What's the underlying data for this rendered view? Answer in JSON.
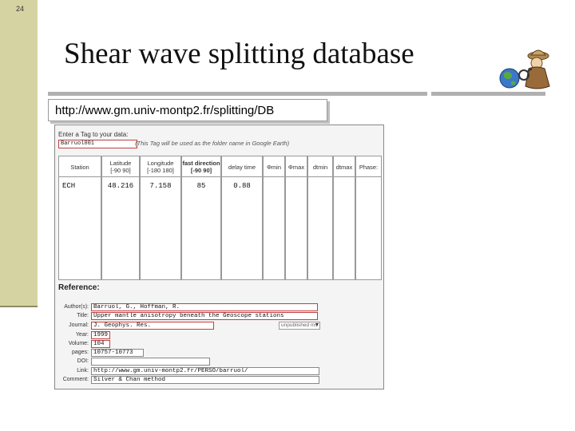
{
  "slide": {
    "number": "24",
    "title": "Shear wave splitting database",
    "url": "http://www.gm.univ-montp2.fr/splitting/DB"
  },
  "form": {
    "tag_label": "Enter a Tag to your data:",
    "tag_value": "Barruol001",
    "tag_note": "(This Tag will be used as the folder name in Google Earth)",
    "headers": {
      "station": "Station",
      "latitude": "Latitude",
      "latitude_range": "[-90 90]",
      "longitude": "Longitude",
      "longitude_range": "[-180 180]",
      "fast_direction": "fast direction",
      "fast_direction_range": "[-90 90]",
      "delay_time": "delay time",
      "phi_min": "Φmin",
      "phi_max": "Φmax",
      "dt_min": "dtmin",
      "dt_max": "dtmax",
      "phase": "Phase:"
    },
    "row": {
      "station": "ECH",
      "latitude": "48.216",
      "longitude": "7.158",
      "fast_direction": "85",
      "delay_time": "0.88"
    },
    "reference": {
      "title": "Reference:",
      "labels": {
        "authors": "Author(s):",
        "title": "Title:",
        "journal": "Journal:",
        "year": "Year:",
        "volume": "Volume:",
        "pages": "pages:",
        "doi": "DOI:",
        "link": "Link:",
        "comment": "Comment:"
      },
      "values": {
        "authors": "Barruol, G., Hoffman, R.",
        "title": "Upper mantle anisotropy beneath the Geoscope stations",
        "journal": "J. Geophys. Res.",
        "journal_select": "unpublished ms",
        "year": "1999",
        "volume": "104",
        "pages": "10757-10773",
        "doi": "",
        "link": "http://www.gm.univ-montp2.fr/PERSO/barruol/",
        "comment": "Silver & Chan method"
      }
    }
  },
  "colors": {
    "sidebar": "#d6d3a2",
    "field_border": "#c04040"
  },
  "icons": {
    "mascot": "globe-detective-icon"
  }
}
